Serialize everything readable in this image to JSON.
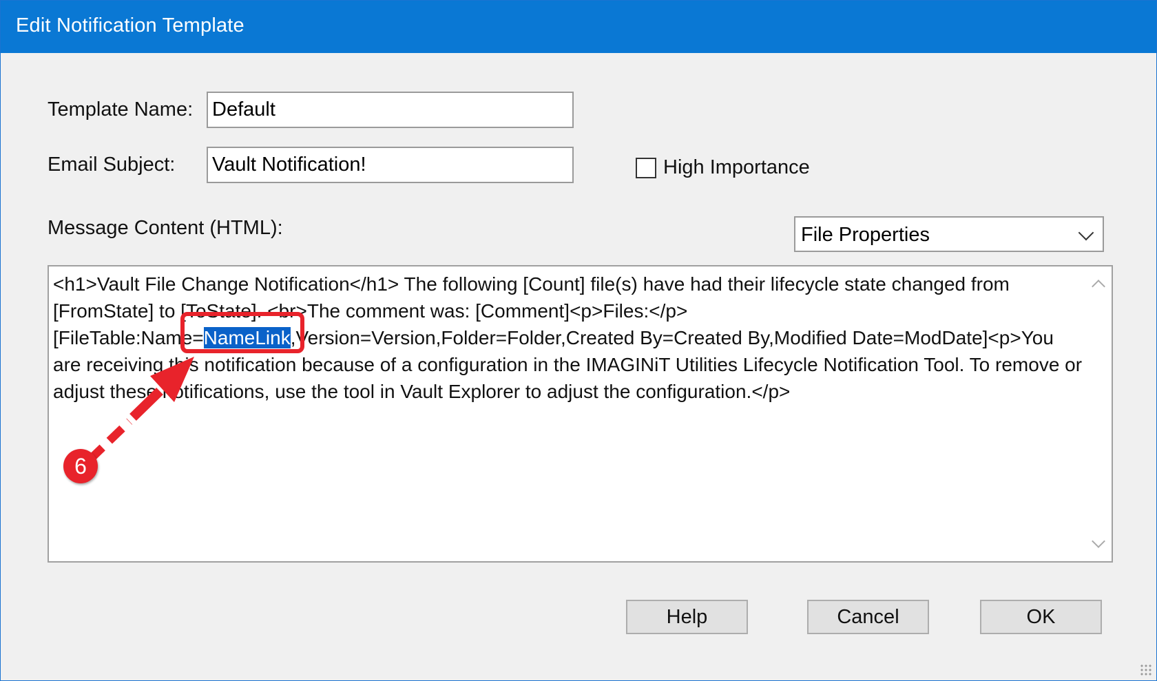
{
  "window": {
    "title": "Edit Notification Template"
  },
  "form": {
    "template_name_label": "Template Name:",
    "template_name_value": "Default",
    "email_subject_label": "Email Subject:",
    "email_subject_value": "Vault Notification!",
    "high_importance_label": "High Importance",
    "high_importance_checked": false,
    "message_content_label": "Message Content (HTML):",
    "properties_select_value": "File Properties",
    "message_before_selection": "<h1>Vault File Change Notification</h1> The following [Count] file(s) have had their lifecycle state changed from [FromState] to [ToState]. <br>The comment was: [Comment]<p>Files:</p> [FileTable:Name=",
    "message_selected": "NameLink",
    "message_after_selection": ",Version=Version,Folder=Folder,Created By=Created By,Modified Date=ModDate]<p>You are receiving this notification because of a configuration in the IMAGINiT Utilities Lifecycle Notification Tool. To remove or adjust these notifications, use the tool in Vault Explorer to adjust the configuration.</p>"
  },
  "buttons": {
    "help": "Help",
    "cancel": "Cancel",
    "ok": "OK"
  },
  "annotation": {
    "step_number": "6",
    "color": "#e8232b"
  }
}
